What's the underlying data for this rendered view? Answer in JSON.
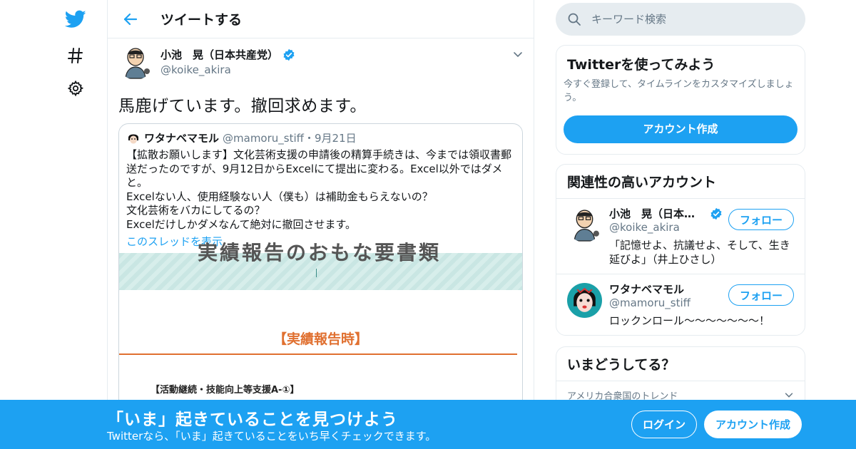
{
  "colors": {
    "brand": "#1da1f2",
    "text": "#14171a",
    "secondary": "#657786",
    "border": "#e6ecf0"
  },
  "nav": {
    "icons": [
      "twitter-logo-icon",
      "hashtag-icon",
      "gear-icon"
    ]
  },
  "header": {
    "title": "ツイートする"
  },
  "tweet": {
    "author_name": "小池　晃（日本共産党）",
    "author_handle": "@koike_akira",
    "text": "馬鹿げています。撤回求めます。",
    "quote": {
      "name": "ワタナベマモル",
      "handle": "@mamoru_stiff",
      "date": "・9月21日",
      "body": "【拡散お願いします】文化芸術支援の申請後の精算手続きは、今までは領収書郵\n送だったのですが、9月12日からExcelにて提出に変わる。Excel以外ではダメ\nと。\nExcelない人、使用経験ない人（僕も）は補助金もらえないの？\n文化芸術をバカにしてるの？\nExcelだけしかダメなんて絶対に撤回させます。",
      "thread_link": "このスレッドを表示",
      "image": {
        "band_text": "実績報告のおもな要書類",
        "heading": "【実績報告時】",
        "sub": "【活動継続・技能向上等支援A-①】"
      }
    }
  },
  "search": {
    "placeholder": "キーワード検索"
  },
  "signup_card": {
    "title": "Twitterを使ってみよう",
    "desc": "今すぐ登録して、タイムラインをカスタマイズしましょう。",
    "button": "アカウント作成"
  },
  "related": {
    "title": "関連性の高いアカウント",
    "accounts": [
      {
        "name": "小池　晃（日本共...",
        "handle": "@koike_akira",
        "verified": true,
        "bio": "「記憶せよ、抗議せよ、そして、生き延びよ」（井上ひさし）",
        "follow": "フォロー"
      },
      {
        "name": "ワタナベマモル",
        "handle": "@mamoru_stiff",
        "verified": false,
        "bio": "ロックンロール～～～～～～～！",
        "follow": "フォロー"
      }
    ]
  },
  "trends": {
    "title": "いまどうしてる？",
    "location": "アメリカ合衆国のトレンド"
  },
  "bottom_bar": {
    "title": "「いま」起きていることを見つけよう",
    "subtitle": "Twitterなら、「いま」起きていることをいち早くチェックできます。",
    "login": "ログイン",
    "signup": "アカウント作成"
  }
}
